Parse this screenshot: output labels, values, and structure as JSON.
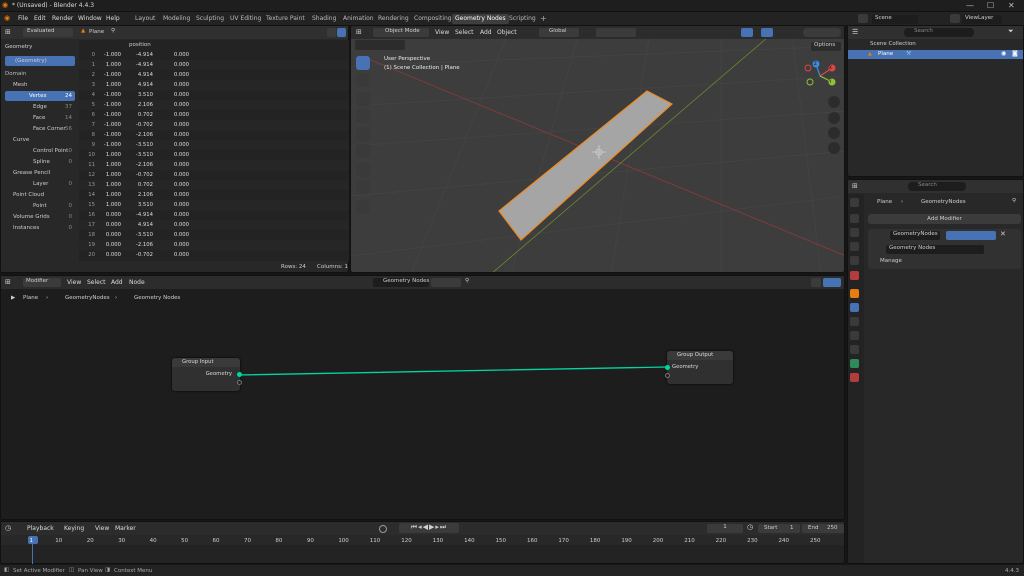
{
  "window": {
    "title": "* (Unsaved) - Blender 4.4.3"
  },
  "menus": [
    "File",
    "Edit",
    "Render",
    "Window",
    "Help"
  ],
  "workspaces": [
    "Layout",
    "Modeling",
    "Sculpting",
    "UV Editing",
    "Texture Paint",
    "Shading",
    "Animation",
    "Rendering",
    "Compositing",
    "Geometry Nodes",
    "Scripting"
  ],
  "active_workspace": "Geometry Nodes",
  "scene": "Scene",
  "view_layer": "ViewLayer",
  "spreadsheet": {
    "mode": "Evaluated",
    "object": "Plane",
    "tree": [
      {
        "label": "Geometry",
        "num": ""
      },
      {
        "label": "(Geometry)",
        "num": ""
      },
      {
        "label": "Domain",
        "num": ""
      },
      {
        "label": "Mesh",
        "num": ""
      },
      {
        "label": "Vertex",
        "num": "24"
      },
      {
        "label": "Edge",
        "num": "37"
      },
      {
        "label": "Face",
        "num": "14"
      },
      {
        "label": "Face Corner",
        "num": "56"
      },
      {
        "label": "Curve",
        "num": ""
      },
      {
        "label": "Control Point",
        "num": "0"
      },
      {
        "label": "Spline",
        "num": "0"
      },
      {
        "label": "Grease Pencil",
        "num": ""
      },
      {
        "label": "Layer",
        "num": "0"
      },
      {
        "label": "Point Cloud",
        "num": ""
      },
      {
        "label": "Point",
        "num": "0"
      },
      {
        "label": "Volume Grids",
        "num": "0"
      },
      {
        "label": "Instances",
        "num": "0"
      }
    ],
    "column_header": "position",
    "rows": [
      [
        "0",
        "-1.000",
        "-4.914",
        "0.000"
      ],
      [
        "1",
        "1.000",
        "-4.914",
        "0.000"
      ],
      [
        "2",
        "-1.000",
        "4.914",
        "0.000"
      ],
      [
        "3",
        "1.000",
        "4.914",
        "0.000"
      ],
      [
        "4",
        "-1.000",
        "3.510",
        "0.000"
      ],
      [
        "5",
        "-1.000",
        "2.106",
        "0.000"
      ],
      [
        "6",
        "-1.000",
        "0.702",
        "0.000"
      ],
      [
        "7",
        "-1.000",
        "-0.702",
        "0.000"
      ],
      [
        "8",
        "-1.000",
        "-2.106",
        "0.000"
      ],
      [
        "9",
        "-1.000",
        "-3.510",
        "0.000"
      ],
      [
        "10",
        "1.000",
        "-3.510",
        "0.000"
      ],
      [
        "11",
        "1.000",
        "-2.106",
        "0.000"
      ],
      [
        "12",
        "1.000",
        "-0.702",
        "0.000"
      ],
      [
        "13",
        "1.000",
        "0.702",
        "0.000"
      ],
      [
        "14",
        "1.000",
        "2.106",
        "0.000"
      ],
      [
        "15",
        "1.000",
        "3.510",
        "0.000"
      ],
      [
        "16",
        "0.000",
        "-4.914",
        "0.000"
      ],
      [
        "17",
        "0.000",
        "4.914",
        "0.000"
      ],
      [
        "18",
        "0.000",
        "-3.510",
        "0.000"
      ],
      [
        "19",
        "0.000",
        "-2.106",
        "0.000"
      ],
      [
        "20",
        "0.000",
        "-0.702",
        "0.000"
      ]
    ],
    "rows_label": "Rows: 24",
    "cols_label": "Columns: 1"
  },
  "viewport": {
    "mode": "Object Mode",
    "menus": [
      "View",
      "Select",
      "Add",
      "Object"
    ],
    "transform": "Global",
    "options": "Options",
    "perspective": "User Perspective",
    "collection": "(1) Scene Collection | Plane"
  },
  "gizmo": {
    "x": "X",
    "y": "Y",
    "z": "Z"
  },
  "outliner": {
    "root": "Scene Collection",
    "item": "Plane",
    "search": "Search"
  },
  "properties": {
    "search": "Search",
    "breadcrumb_obj": "Plane",
    "breadcrumb_mod": "GeometryNodes",
    "add_modifier": "Add Modifier",
    "modifier_name": "GeometryNodes",
    "node_group": "Geometry Nodes",
    "manage": "Manage"
  },
  "node_editor": {
    "mode": "Modifier",
    "menus": [
      "View",
      "Select",
      "Add",
      "Node"
    ],
    "tree_name": "Geometry Nodes",
    "breadcrumb": [
      "Plane",
      "GeometryNodes",
      "Geometry Nodes"
    ],
    "group_input": {
      "title": "Group Input",
      "socket": "Geometry"
    },
    "group_output": {
      "title": "Group Output",
      "socket": "Geometry"
    },
    "link_color": "#00d6a3"
  },
  "timeline": {
    "menus": [
      "Playback",
      "Keying",
      "View",
      "Marker"
    ],
    "current": "1",
    "start_label": "Start",
    "start": "1",
    "end_label": "End",
    "end": "250",
    "ticks": [
      "1",
      "10",
      "20",
      "30",
      "40",
      "50",
      "60",
      "70",
      "80",
      "90",
      "100",
      "110",
      "120",
      "130",
      "140",
      "150",
      "160",
      "170",
      "180",
      "190",
      "200",
      "210",
      "220",
      "230",
      "240",
      "250"
    ]
  },
  "statusbar": {
    "items": [
      "Set Active Modifier",
      "Pan View",
      "Context Menu"
    ],
    "version": "4.4.3"
  }
}
